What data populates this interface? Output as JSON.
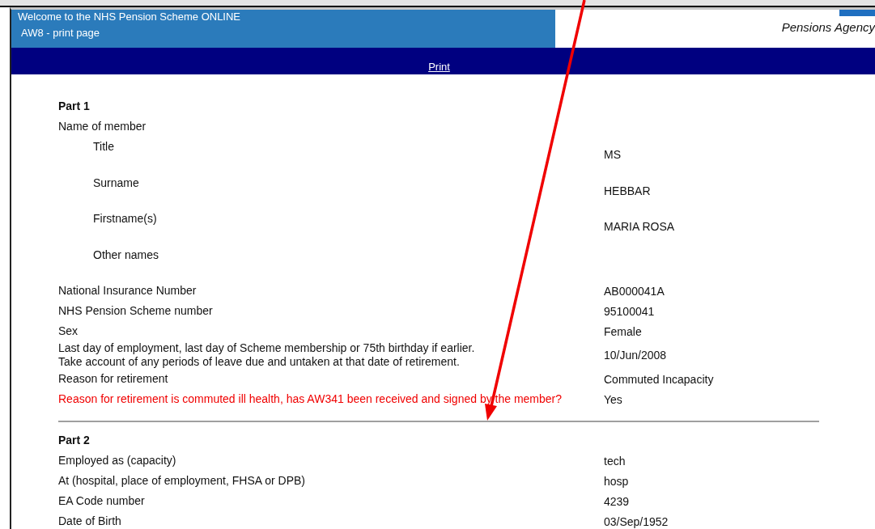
{
  "header": {
    "title": "Welcome to the NHS Pension Scheme ONLINE",
    "subtitle": "AW8 - print page",
    "agency": "Pensions Agency"
  },
  "nav": {
    "link": "Print"
  },
  "parts": [
    {
      "heading": "Part 1",
      "rows": [
        {
          "label": "Name of member",
          "kind": "normal",
          "children": [
            {
              "label": "Title",
              "value": "MS"
            },
            {
              "label": "Surname",
              "value": "HEBBAR"
            },
            {
              "label": "Firstname(s)",
              "value": "MARIA ROSA"
            },
            {
              "label": "Other names"
            }
          ]
        },
        {
          "label": "National Insurance Number",
          "value": "AB000041A",
          "kind": "normal"
        },
        {
          "label": "NHS Pension Scheme number",
          "value": "95100041",
          "kind": "normal"
        },
        {
          "label": "Sex",
          "value": "Female",
          "kind": "normal"
        },
        {
          "label": "Last day of employment, last day of Scheme membership or 75th birthday if earlier.\nTake account of any periods of leave due and untaken at that date of retirement.",
          "value": "10/Jun/2008",
          "kind": "normal"
        },
        {
          "label": "Reason for retirement",
          "value": "Commuted Incapacity",
          "kind": "normal"
        },
        {
          "label": "Reason for retirement is commuted ill health, has AW341 been received and signed by the member?",
          "value": "Yes",
          "kind": "warning"
        }
      ]
    },
    {
      "heading": "Part 2",
      "rows": [
        {
          "label": "Employed as (capacity)",
          "value": "tech",
          "kind": "normal"
        },
        {
          "label": "At (hospital, place of employment, FHSA or DPB)",
          "value": "hosp",
          "kind": "normal"
        },
        {
          "label": "EA Code number",
          "value": "4239",
          "kind": "normal"
        },
        {
          "label": "Date of Birth",
          "value": "03/Sep/1952",
          "kind": "normal"
        }
      ]
    }
  ]
}
